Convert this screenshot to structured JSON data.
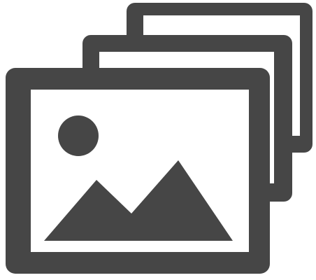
{
  "icon": {
    "name": "image-gallery-icon",
    "color": "#464646",
    "background": "#ffffff"
  }
}
